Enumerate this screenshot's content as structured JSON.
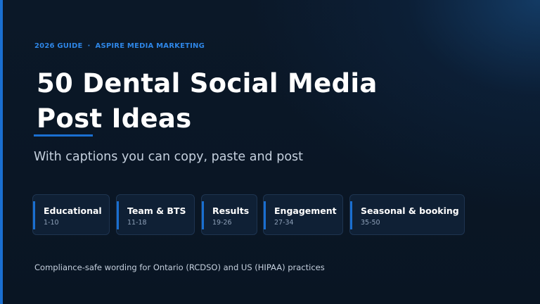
{
  "eyebrow": {
    "guide": "2026 GUIDE",
    "separator": "·",
    "brand": "ASPIRE MEDIA MARKETING"
  },
  "title": {
    "line1": "50 Dental Social Media",
    "line2": "Post Ideas"
  },
  "subtitle": "With captions you can copy, paste and post",
  "categories": [
    {
      "label": "Educational",
      "range": "1-10"
    },
    {
      "label": "Team & BTS",
      "range": "11-18"
    },
    {
      "label": "Results",
      "range": "19-26"
    },
    {
      "label": "Engagement",
      "range": "27-34"
    },
    {
      "label": "Seasonal & booking",
      "range": "35-50"
    }
  ],
  "footer": "Compliance-safe wording for Ontario (RCDSO) and US (HIPAA) practices",
  "colors": {
    "background": "#0a1626",
    "accent": "#1a6fd1",
    "eyebrow": "#2e86e6",
    "card_background": "#0f2035",
    "muted_text": "#c5d0de"
  }
}
